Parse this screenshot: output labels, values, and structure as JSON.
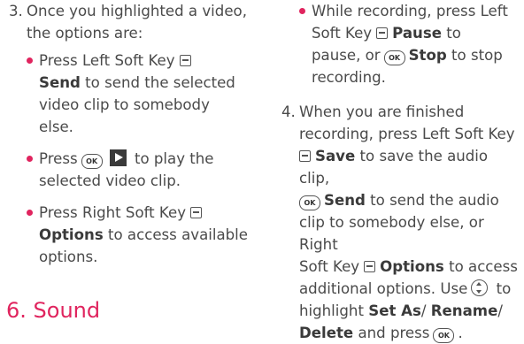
{
  "left": {
    "step3": {
      "number": "3.",
      "intro_line1": "Once you highlighted a video,",
      "intro_line2": "the options are:"
    },
    "b1": {
      "l1": "Press Left Soft Key",
      "send": "Send",
      "l2": " to send the selected",
      "l3": "video clip to somebody else."
    },
    "b2": {
      "press": "Press",
      "to_play": " to play the",
      "l2": "selected video clip."
    },
    "b3": {
      "l1": "Press Right Soft Key",
      "options": "Options",
      "l2": " to access available",
      "l3": "options."
    }
  },
  "section_heading": "6. Sound",
  "right": {
    "b1": {
      "l1": "While recording, press Left",
      "soft_key": "Soft Key",
      "pause": "Pause",
      "to": " to",
      "l3a": "pause, or",
      "stop": "Stop",
      "to_stop": " to stop",
      "l4": "recording."
    },
    "step4": {
      "number": "4.",
      "l1": "When you are finished",
      "l2": "recording, press Left Soft Key",
      "save": "Save",
      "l3": " to save the audio clip,",
      "send": "Send",
      "l4": " to send the audio",
      "l5": "clip to somebody else, or Right",
      "l6a": "Soft Key",
      "options": "Options",
      "l6b": " to access",
      "l7a": "additional options. Use",
      "l7b": " to",
      "l8": "highlight",
      "set_as": "Set As",
      "slash1": "/ ",
      "rename": "Rename",
      "slash2": "/",
      "delete": "Delete",
      "l9": " and press",
      "period": "."
    }
  },
  "icons": {
    "soft_key": "soft-key-icon",
    "ok_key": "ok-key-icon",
    "ok_label": "OK",
    "play": "play-icon",
    "nav": "nav-key-icon",
    "bullet_color": "#e0245e",
    "heading_color": "#e0245e"
  }
}
